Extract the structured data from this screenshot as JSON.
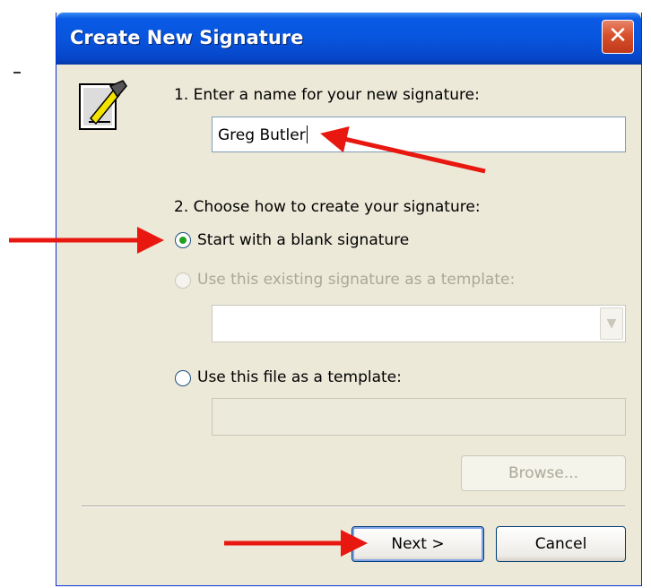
{
  "dialog": {
    "title": "Create New Signature",
    "close_glyph": "✕"
  },
  "step1": {
    "label": "1. Enter a name for your new signature:",
    "name_value": "Greg Butler"
  },
  "step2": {
    "label": "2. Choose how to create your signature:",
    "options": [
      {
        "label": "Start with a blank signature",
        "selected": true,
        "enabled": true
      },
      {
        "label": "Use this existing signature as a template:",
        "selected": false,
        "enabled": false
      },
      {
        "label": "Use this file as a template:",
        "selected": false,
        "enabled": true
      }
    ],
    "template_select_value": "",
    "file_path_value": ""
  },
  "buttons": {
    "browse": "Browse...",
    "next": "Next >",
    "cancel": "Cancel"
  },
  "icons": {
    "wizard": "signature-wizard-icon",
    "dropdown": "chevron-down-icon"
  },
  "colors": {
    "titlebar": "#0855dd",
    "dialog_bg": "#ece9d8",
    "annotation_arrow": "#e8170f",
    "radio_selected": "#21a121"
  }
}
